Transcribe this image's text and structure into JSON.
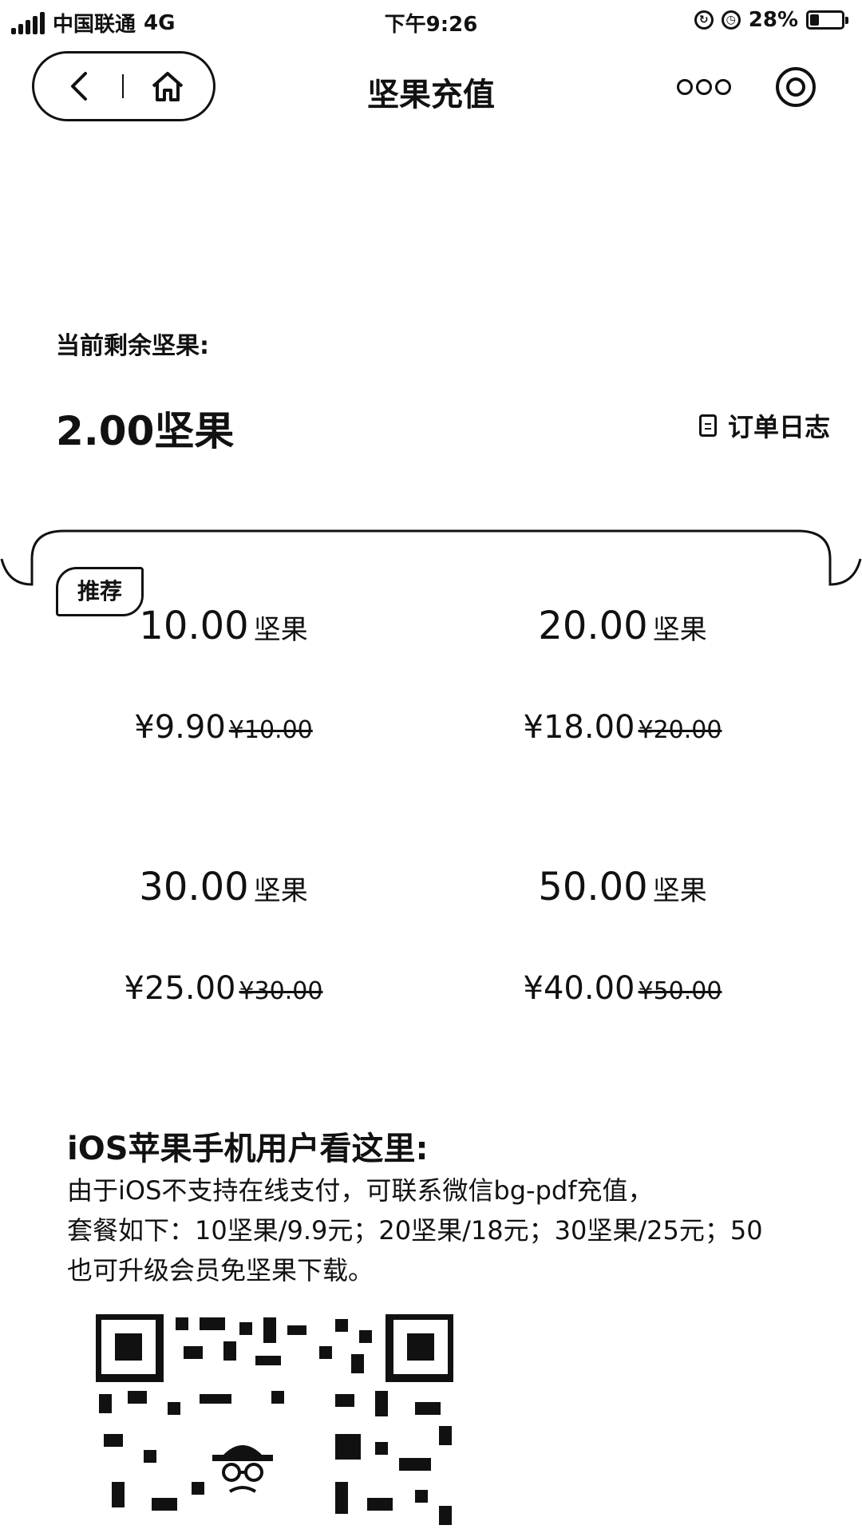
{
  "status_bar": {
    "carrier": "中国联通",
    "network": "4G",
    "time": "下午9:26",
    "battery_percent": "28%",
    "battery_level": 0.28,
    "icons": [
      "signal-icon",
      "screen-rotation-lock-icon",
      "alarm-icon",
      "battery-icon"
    ]
  },
  "nav": {
    "title": "坚果充值",
    "icons": [
      "back-icon",
      "home-icon",
      "more-icon",
      "close-target-icon"
    ]
  },
  "balance": {
    "label": "当前剩余坚果:",
    "value": "2.00坚果",
    "order_log": "订单日志"
  },
  "packages": {
    "badge": "推荐",
    "items": [
      {
        "amount": "10.00",
        "unit": "坚果",
        "price": "¥9.90",
        "original": "¥10.00"
      },
      {
        "amount": "20.00",
        "unit": "坚果",
        "price": "¥18.00",
        "original": "¥20.00"
      },
      {
        "amount": "30.00",
        "unit": "坚果",
        "price": "¥25.00",
        "original": "¥30.00"
      },
      {
        "amount": "50.00",
        "unit": "坚果",
        "price": "¥40.00",
        "original": "¥50.00"
      }
    ]
  },
  "ios_note": {
    "title": "iOS苹果手机用户看这里:",
    "lines": [
      "由于iOS不支持在线支付，可联系微信bg-pdf充值，",
      "套餐如下：10坚果/9.9元；20坚果/18元；30坚果/25元；50",
      "也可升级会员免坚果下载。"
    ]
  },
  "colors": {
    "foreground": "#111111",
    "background": "#ffffff"
  }
}
